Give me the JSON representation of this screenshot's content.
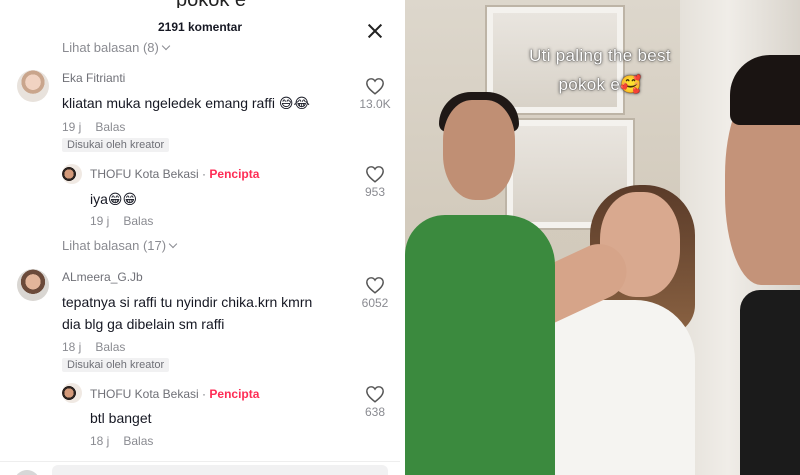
{
  "comments_panel": {
    "top_text": "pokok e",
    "header_title": "2191 komentar",
    "top_more_replies": "Lihat balasan (8)",
    "comments": [
      {
        "username": "Eka Fitrianti",
        "text": "kliatan muka ngeledek emang raffi 😅😂",
        "time": "19 j",
        "reply_label": "Balas",
        "liked_badge": "Disukai oleh kreator",
        "likes": "13.0K",
        "reply": {
          "username": "THOFU Kota Bekasi",
          "separator": "·",
          "creator_label": "Pencipta",
          "text": "iya😁😁",
          "time": "19 j",
          "reply_label": "Balas",
          "likes": "953"
        },
        "more_replies": "Lihat balasan (17)"
      },
      {
        "username": "ALmeera_G.Jb",
        "text_line1": "tepatnya si raffi tu nyindir chika.krn kmrn",
        "text_line2": "dia blg ga dibelain sm raffi",
        "time": "18 j",
        "reply_label": "Balas",
        "liked_badge": "Disukai oleh kreator",
        "likes": "6052",
        "reply": {
          "username": "THOFU Kota Bekasi",
          "separator": "·",
          "creator_label": "Pencipta",
          "text": "btl banget",
          "time": "18 j",
          "reply_label": "Balas",
          "likes": "638"
        }
      }
    ],
    "icons": {
      "close": "close-icon",
      "like": "heart-icon",
      "expand": "chevron-down-icon"
    }
  },
  "video": {
    "caption_line1": "Uti paling the best",
    "caption_line2": "pokok e🥰"
  },
  "colors": {
    "creator_accent": "#fe2c55",
    "secondary_text": "#8a8b91",
    "primary_text": "#161823"
  }
}
